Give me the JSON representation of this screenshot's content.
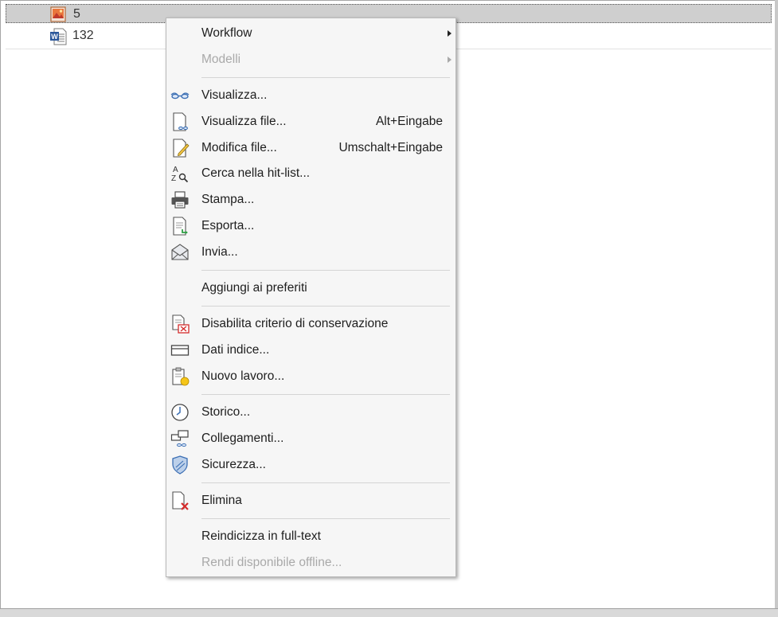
{
  "list": {
    "rows": [
      {
        "label": "5",
        "icon": "image-document-icon"
      },
      {
        "label": "132",
        "icon": "word-document-icon"
      }
    ]
  },
  "menu": {
    "items": [
      {
        "key": "workflow",
        "label": "Workflow",
        "shortcut": "",
        "submenu": true,
        "disabled": false,
        "icon": ""
      },
      {
        "key": "modelli",
        "label": "Modelli",
        "shortcut": "",
        "submenu": true,
        "disabled": true,
        "icon": ""
      },
      {
        "key": "visualizza",
        "label": "Visualizza...",
        "shortcut": "",
        "disabled": false,
        "icon": "glasses-icon"
      },
      {
        "key": "visualizza-file",
        "label": "Visualizza file...",
        "shortcut": "Alt+Eingabe",
        "disabled": false,
        "icon": "view-file-icon"
      },
      {
        "key": "modifica-file",
        "label": "Modifica file...",
        "shortcut": "Umschalt+Eingabe",
        "disabled": false,
        "icon": "edit-file-icon"
      },
      {
        "key": "cerca",
        "label": "Cerca nella hit-list...",
        "shortcut": "",
        "disabled": false,
        "icon": "az-search-icon"
      },
      {
        "key": "stampa",
        "label": "Stampa...",
        "shortcut": "",
        "disabled": false,
        "icon": "printer-icon"
      },
      {
        "key": "esporta",
        "label": "Esporta...",
        "shortcut": "",
        "disabled": false,
        "icon": "export-icon"
      },
      {
        "key": "invia",
        "label": "Invia...",
        "shortcut": "",
        "disabled": false,
        "icon": "envelope-icon"
      },
      {
        "key": "preferiti",
        "label": "Aggiungi ai preferiti",
        "shortcut": "",
        "disabled": false,
        "icon": ""
      },
      {
        "key": "disabilita",
        "label": "Disabilita criterio di conservazione",
        "shortcut": "",
        "disabled": false,
        "icon": "retention-icon"
      },
      {
        "key": "dati-indice",
        "label": "Dati indice...",
        "shortcut": "",
        "disabled": false,
        "icon": "index-data-icon"
      },
      {
        "key": "nuovo-lavoro",
        "label": "Nuovo lavoro...",
        "shortcut": "",
        "disabled": false,
        "icon": "new-task-icon"
      },
      {
        "key": "storico",
        "label": "Storico...",
        "shortcut": "",
        "disabled": false,
        "icon": "clock-icon"
      },
      {
        "key": "collegamenti",
        "label": "Collegamenti...",
        "shortcut": "",
        "disabled": false,
        "icon": "links-icon"
      },
      {
        "key": "sicurezza",
        "label": "Sicurezza...",
        "shortcut": "",
        "disabled": false,
        "icon": "shield-icon"
      },
      {
        "key": "elimina",
        "label": "Elimina",
        "shortcut": "",
        "disabled": false,
        "icon": "delete-file-icon"
      },
      {
        "key": "reindicizza",
        "label": "Reindicizza in full-text",
        "shortcut": "",
        "disabled": false,
        "icon": ""
      },
      {
        "key": "offline",
        "label": "Rendi disponibile offline...",
        "shortcut": "",
        "disabled": true,
        "icon": ""
      }
    ]
  },
  "colors": {
    "accent_blue": "#3c6fb4",
    "delete_red": "#d42b2b",
    "disabled_text": "#a9a9a9",
    "menu_bg": "#f6f6f6"
  }
}
